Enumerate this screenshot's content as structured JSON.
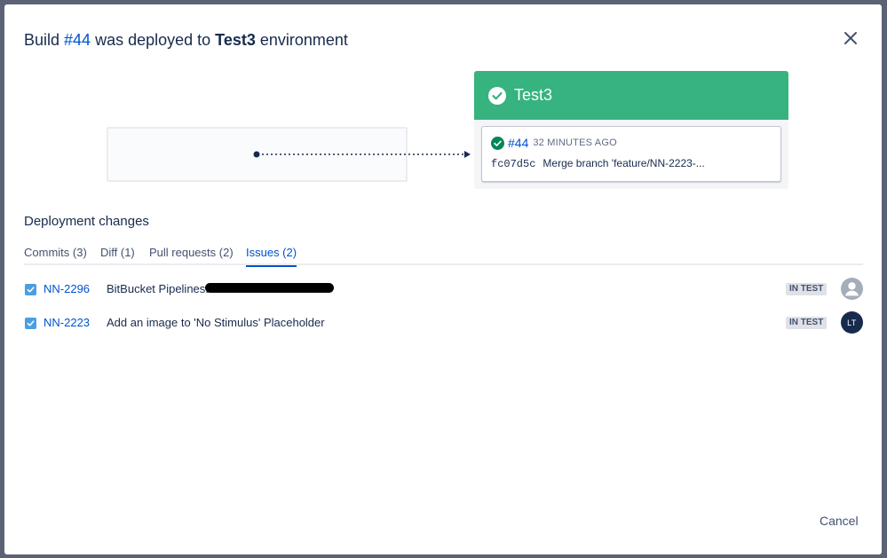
{
  "dialog": {
    "title_prefix": "Build ",
    "build_number": "#44",
    "title_middle": " was deployed to ",
    "environment_name": "Test3",
    "title_suffix": " environment",
    "close_icon": "close-icon"
  },
  "environment_card": {
    "name": "Test3",
    "header_color": "#36b37e",
    "icon": "check-circle-icon",
    "build": {
      "number": "#44",
      "time_ago": "32 MINUTES AGO",
      "commit_hash": "fc07d5c",
      "commit_message": "Merge branch 'feature/NN-2223-...",
      "status_icon": "success-check-icon"
    }
  },
  "deployment_changes": {
    "title": "Deployment changes",
    "tabs": [
      {
        "label": "Commits (3)",
        "active": false
      },
      {
        "label": "Diff (1)",
        "active": false
      },
      {
        "label": "Pull requests (2)",
        "active": false
      },
      {
        "label": "Issues (2)",
        "active": true
      }
    ],
    "issues": [
      {
        "checked": true,
        "key": "NN-2296",
        "summary": "BitBucket Pipelines:",
        "summary_redacted": true,
        "status": "IN TEST",
        "assignee_avatar": "default-user-avatar",
        "assignee_initials": ""
      },
      {
        "checked": true,
        "key": "NN-2223",
        "summary": "Add an image to 'No Stimulus' Placeholder",
        "summary_redacted": false,
        "status": "IN TEST",
        "assignee_avatar": "initials-avatar",
        "assignee_initials": "LT"
      }
    ]
  },
  "footer": {
    "cancel_label": "Cancel"
  },
  "colors": {
    "link": "#0052cc",
    "success": "#36b37e",
    "text": "#172b4d",
    "checkbox": "#4a9fe0"
  }
}
